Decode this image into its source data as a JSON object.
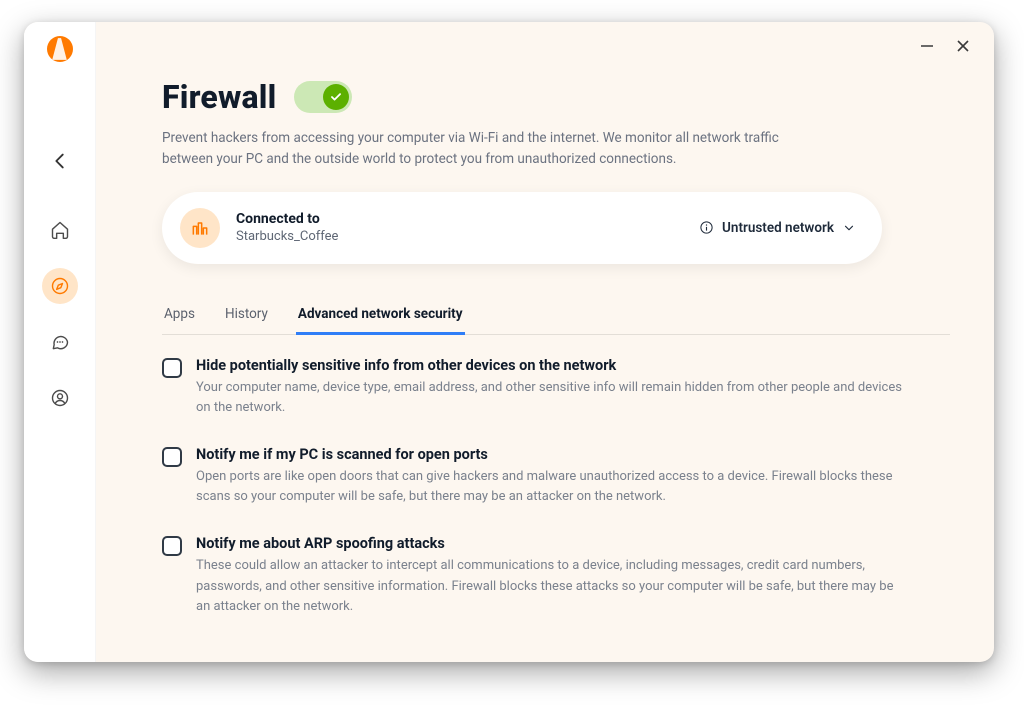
{
  "page": {
    "title": "Firewall",
    "description": "Prevent hackers from accessing your computer via Wi-Fi and the internet. We monitor all network traffic between your PC and the outside world to protect you from unauthorized connections.",
    "toggle_enabled": true
  },
  "connection": {
    "label": "Connected to",
    "network_name": "Starbucks_Coffee",
    "trust_label": "Untrusted network"
  },
  "tabs": {
    "apps": "Apps",
    "history": "History",
    "advanced": "Advanced network security",
    "active": "advanced"
  },
  "settings": [
    {
      "title": "Hide potentially sensitive info from other devices on the network",
      "description": "Your computer name, device type, email address, and other sensitive info will remain hidden from other people and devices on the network.",
      "checked": false
    },
    {
      "title": "Notify me if my PC is scanned for open ports",
      "description": "Open ports are like open doors that can give hackers and malware unauthorized access to a device. Firewall blocks these scans so your computer will be safe, but there may be an attacker on the network.",
      "checked": false
    },
    {
      "title": "Notify me about ARP spoofing attacks",
      "description": "These could allow an attacker to intercept all communications to a device, including messages, credit card numbers, passwords, and other sensitive information. Firewall blocks these attacks so your computer will be safe, but there may be an attacker on the network.",
      "checked": false
    }
  ]
}
